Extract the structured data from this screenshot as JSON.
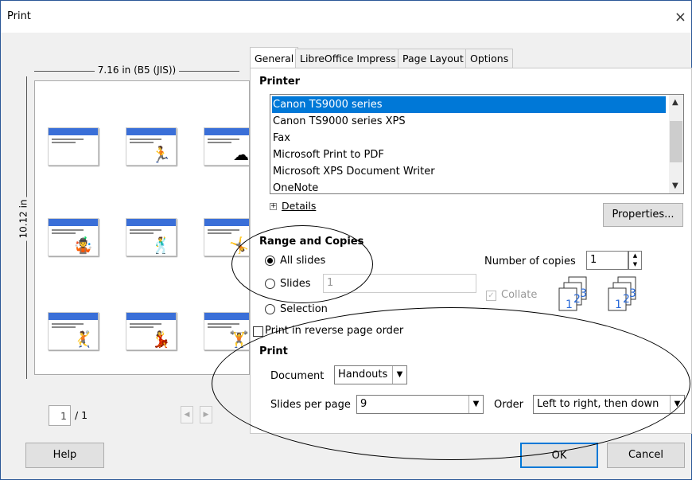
{
  "window": {
    "title": "Print",
    "close": "×"
  },
  "preview": {
    "width_label": "7.16 in (B5 (JIS))",
    "height_label": "10.12 in",
    "page_current": "1",
    "page_total": "/ 1",
    "thumbnails": [
      {
        "title": "An Awesome Presentation",
        "figure": ""
      },
      {
        "title": "First slide",
        "figure": "🏃"
      },
      {
        "title": "Next slide",
        "figure": "☁"
      },
      {
        "title": "Next slide",
        "figure": "🤹"
      },
      {
        "title": "Next slide",
        "figure": "🕺"
      },
      {
        "title": "Next slide",
        "figure": "🤸"
      },
      {
        "title": "Slide",
        "figure": "🤾"
      },
      {
        "title": "Slide",
        "figure": "💃"
      },
      {
        "title": "Slide",
        "figure": "🏋"
      }
    ]
  },
  "tabs": [
    "General",
    "LibreOffice Impress",
    "Page Layout",
    "Options"
  ],
  "printer": {
    "heading": "Printer",
    "items": [
      "Canon TS9000 series",
      "Canon TS9000 series XPS",
      "Fax",
      "Microsoft Print to PDF",
      "Microsoft XPS Document Writer",
      "OneNote"
    ],
    "selected": 0,
    "details": "Details",
    "properties": "Properties..."
  },
  "range": {
    "heading": "Range and Copies",
    "all": "All slides",
    "slides": "Slides",
    "slides_value": "1",
    "selection": "Selection",
    "reverse": "Print in reverse page order",
    "copies_label": "Number of copies",
    "copies_value": "1",
    "collate": "Collate"
  },
  "print": {
    "heading": "Print",
    "document_label": "Document",
    "document_value": "Handouts",
    "spp_label": "Slides per page",
    "spp_value": "9",
    "order_label": "Order",
    "order_value": "Left to right, then down"
  },
  "buttons": {
    "help": "Help",
    "ok": "OK",
    "cancel": "Cancel"
  }
}
